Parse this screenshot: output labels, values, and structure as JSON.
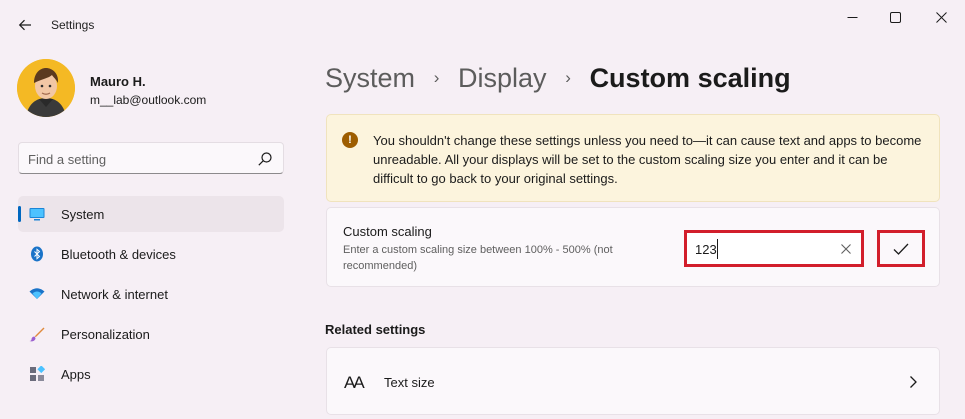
{
  "window": {
    "title": "Settings",
    "controls": {
      "minimize_icon": "minimize-icon",
      "maximize_icon": "maximize-icon",
      "close_icon": "close-icon"
    }
  },
  "user": {
    "name": "Mauro H.",
    "email": "m__lab@outlook.com"
  },
  "search": {
    "placeholder": "Find a setting",
    "value": ""
  },
  "sidebar": {
    "items": [
      {
        "label": "System",
        "icon": "monitor-icon",
        "active": true
      },
      {
        "label": "Bluetooth & devices",
        "icon": "bluetooth-icon",
        "active": false
      },
      {
        "label": "Network & internet",
        "icon": "wifi-icon",
        "active": false
      },
      {
        "label": "Personalization",
        "icon": "brush-icon",
        "active": false
      },
      {
        "label": "Apps",
        "icon": "apps-icon",
        "active": false
      }
    ]
  },
  "breadcrumb": {
    "items": [
      "System",
      "Display",
      "Custom scaling"
    ],
    "separator": "›"
  },
  "warning": {
    "icon": "!",
    "text": "You shouldn't change these settings unless you need to—it can cause text and apps to become unreadable. All your displays will be set to the custom scaling size you enter and it can be difficult to go back to your original settings."
  },
  "custom_scaling": {
    "title": "Custom scaling",
    "description": "Enter a custom scaling size between 100% - 500% (not recommended)",
    "value": "123",
    "apply_icon": "checkmark-icon",
    "clear_icon": "clear-icon"
  },
  "related": {
    "heading": "Related settings",
    "items": [
      {
        "label": "Text size",
        "icon": "text-size-icon",
        "glyph": "AA"
      }
    ]
  },
  "colors": {
    "accent": "#0067c0",
    "highlight_border": "#d21e2b",
    "warning_bg": "#fcf4dd",
    "warning_icon": "#9d5d00"
  }
}
